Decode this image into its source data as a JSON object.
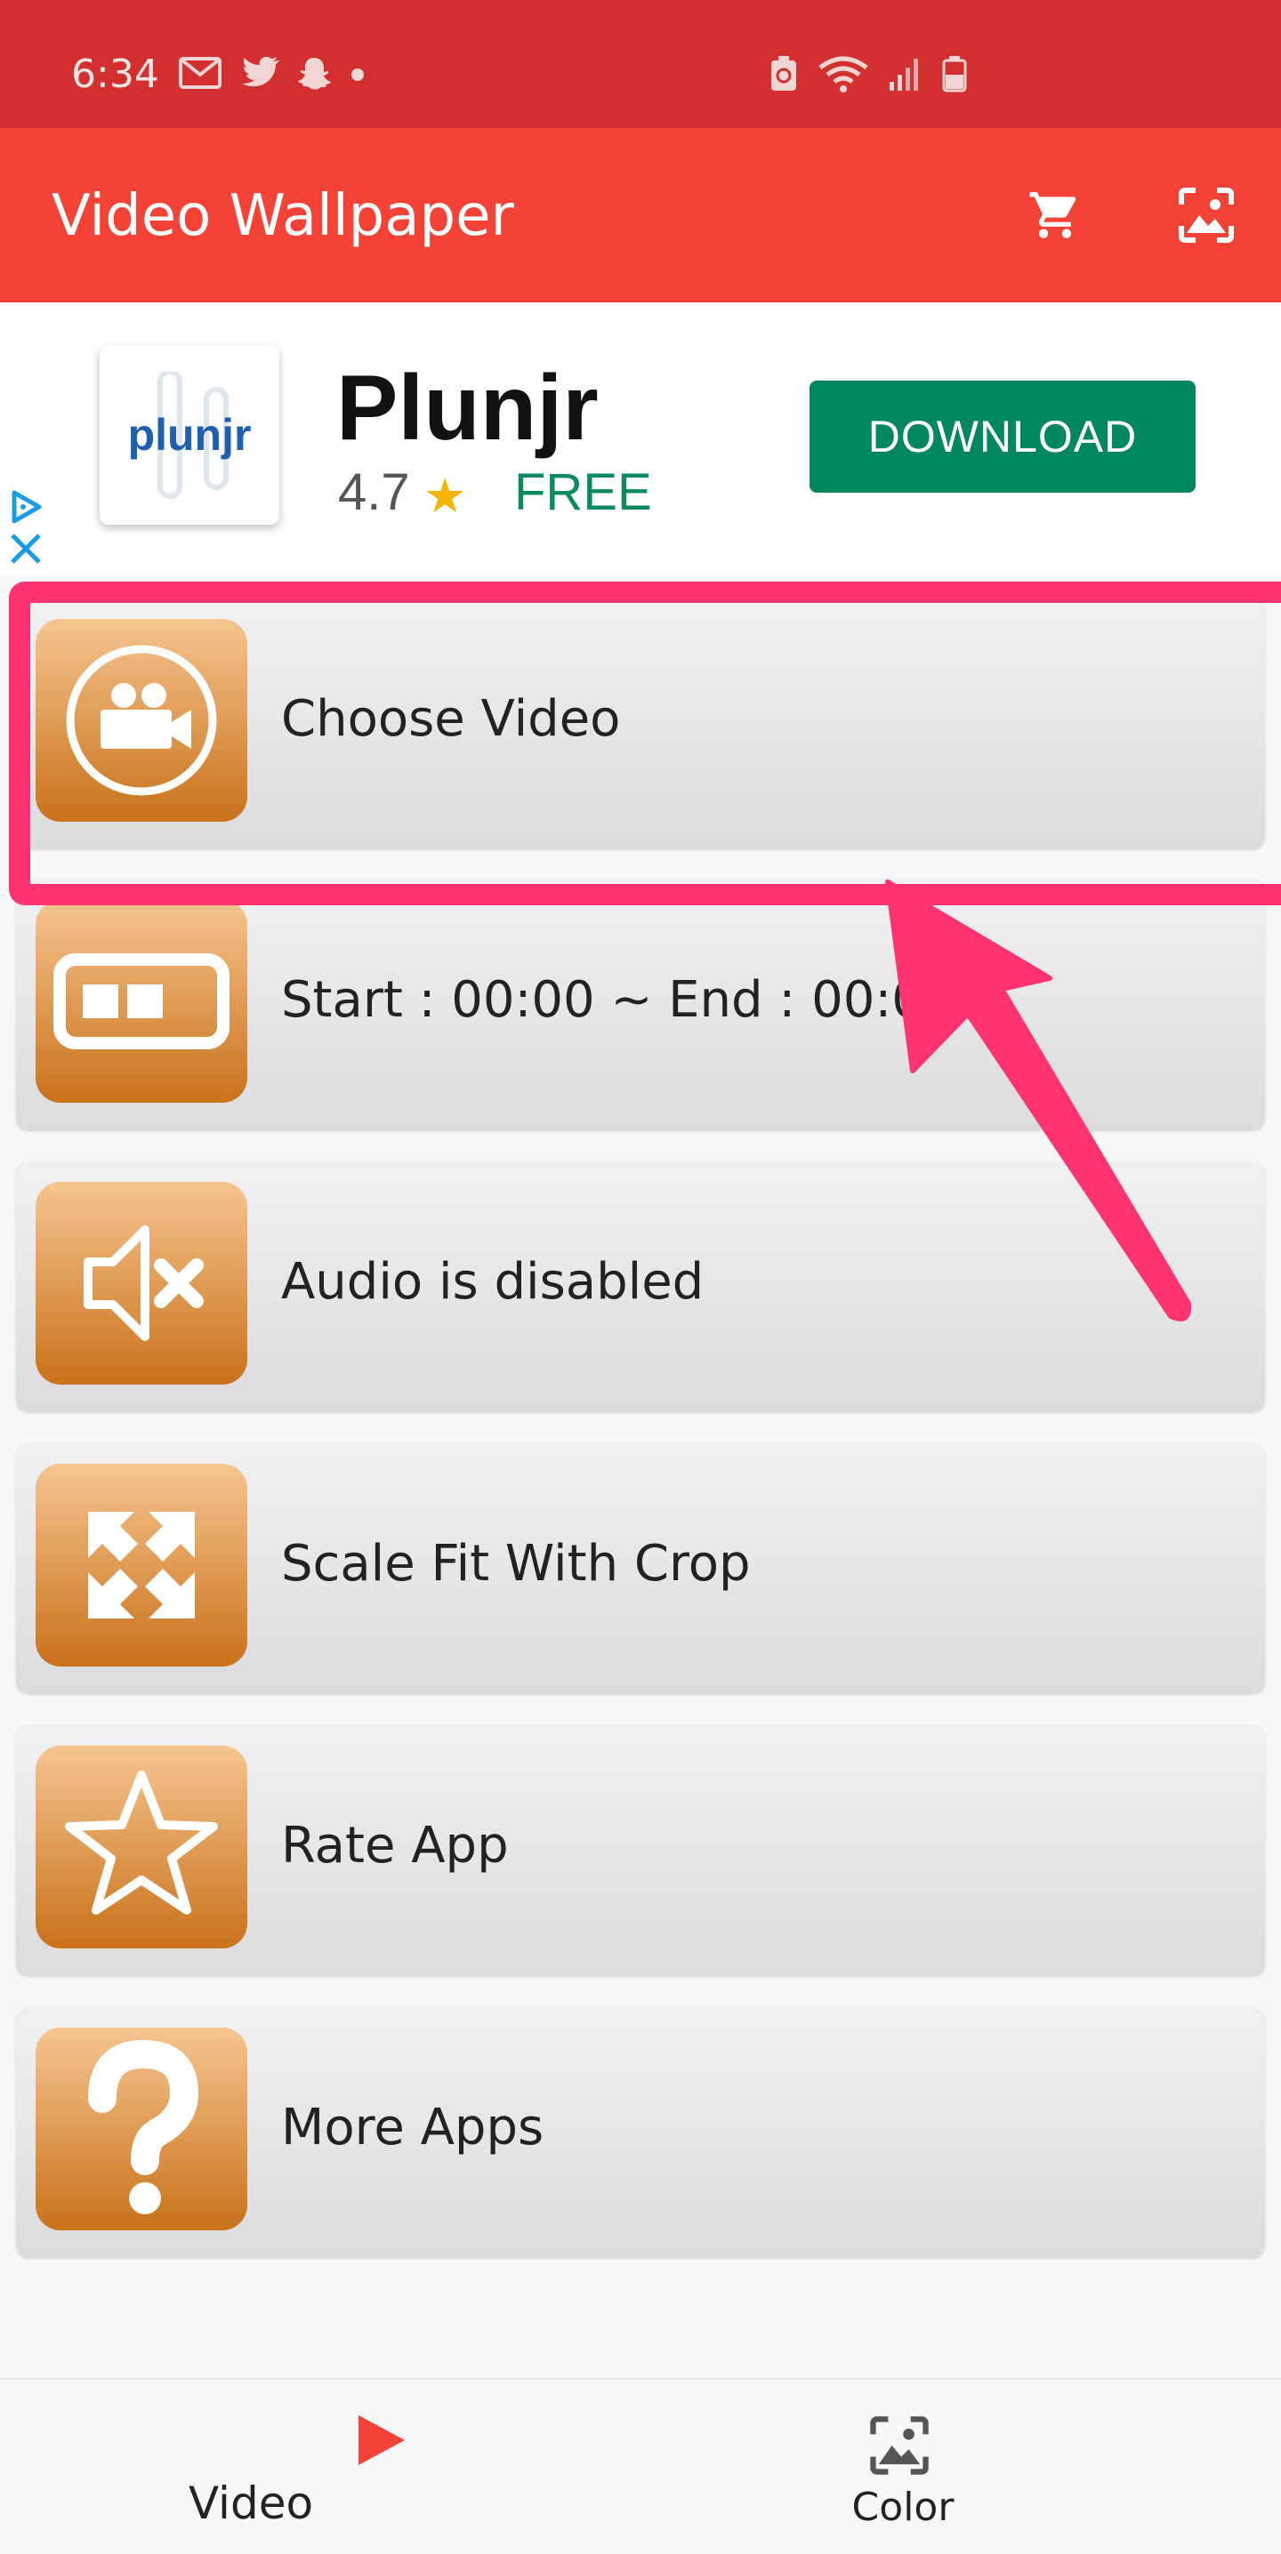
{
  "status": {
    "time": "6:34"
  },
  "app": {
    "title": "Video Wallpaper"
  },
  "ad": {
    "logo_text": "plunjr",
    "title": "Plunjr",
    "rating": "4.7",
    "star": "★",
    "price": "FREE",
    "download_label": "DOWNLOAD"
  },
  "menu": [
    {
      "label": "Choose Video",
      "icon": "video-camera-icon"
    },
    {
      "label": "Start : 00:00 ~ End : 00:00",
      "icon": "trim-range-icon"
    },
    {
      "label": "Audio is disabled",
      "icon": "speaker-muted-icon"
    },
    {
      "label": "Scale Fit With Crop",
      "icon": "expand-arrows-icon"
    },
    {
      "label": "Rate App",
      "icon": "star-icon"
    },
    {
      "label": "More Apps",
      "icon": "question-mark-icon"
    }
  ],
  "nav": {
    "tabs": [
      {
        "label": "Video",
        "icon": "play-icon"
      },
      {
        "label": "Color",
        "icon": "image-icon"
      }
    ]
  },
  "colors": {
    "status_bar": "#d32f2f",
    "app_bar": "#f44336",
    "highlight": "#ff3370",
    "download_button": "#01875f",
    "menu_icon_top": "#f6c590",
    "menu_icon_bottom": "#c9721a",
    "nav_video_icon": "#f44336"
  }
}
